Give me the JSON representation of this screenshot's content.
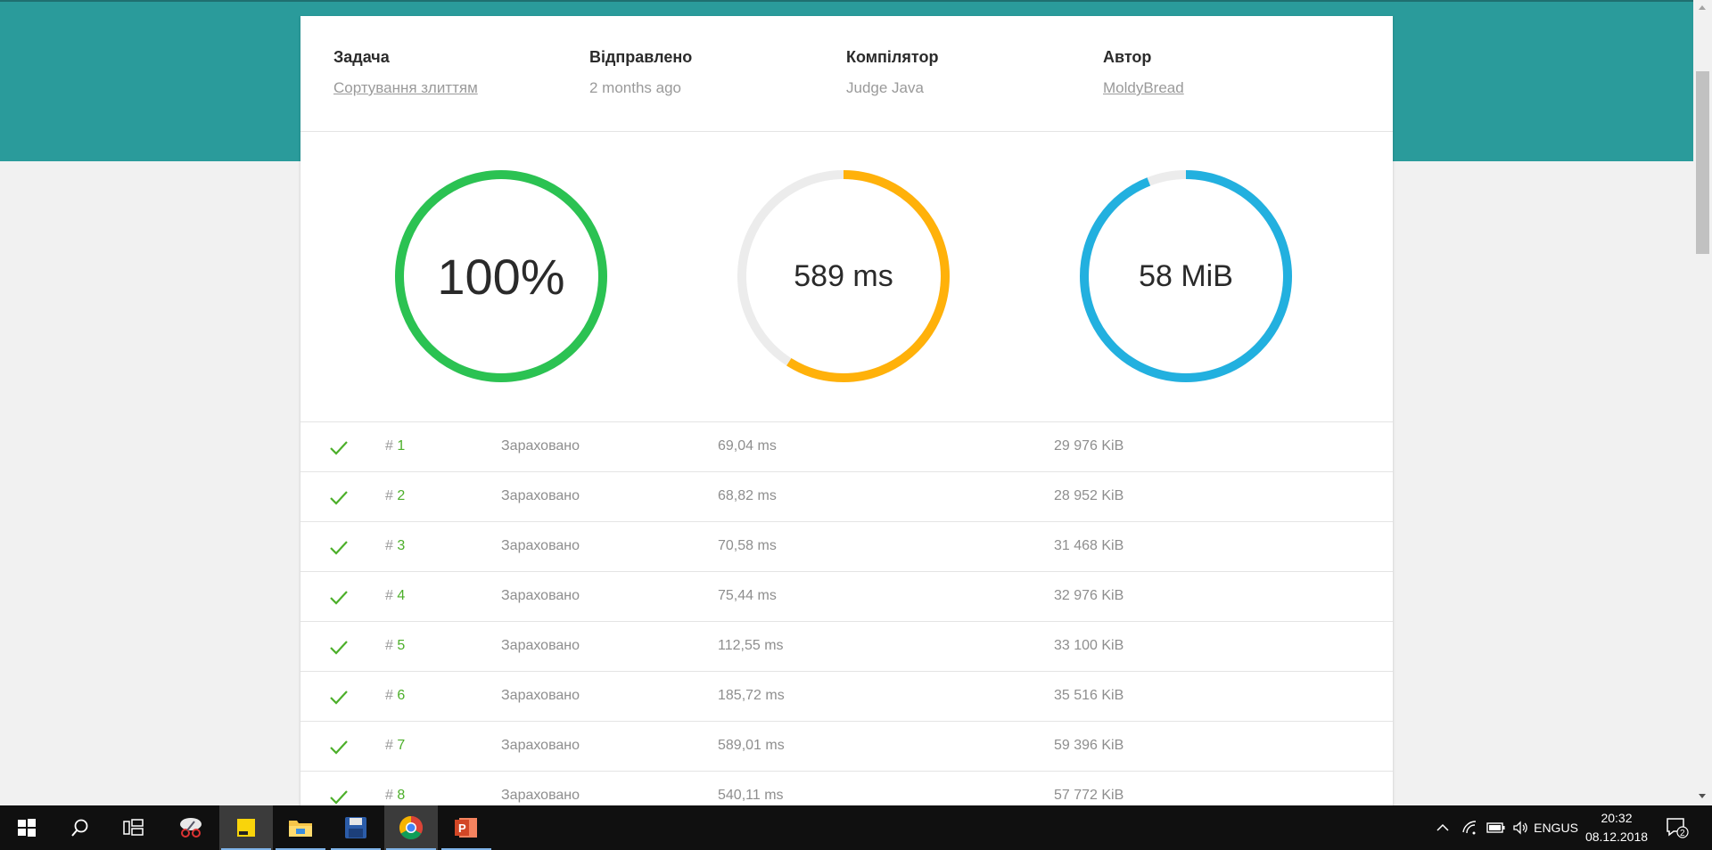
{
  "info": {
    "task": {
      "label": "Задача",
      "value": "Сортування злиттям"
    },
    "sent": {
      "label": "Відправлено",
      "value": "2 months ago"
    },
    "compiler": {
      "label": "Компілятор",
      "value": "Judge Java"
    },
    "author": {
      "label": "Автор",
      "value": "MoldyBread"
    }
  },
  "gauges": {
    "score": {
      "text": "100%",
      "fraction": 1.0,
      "color": "#2bc252"
    },
    "time": {
      "text": "589 ms",
      "fraction": 0.59,
      "color": "#ffb10a"
    },
    "memory": {
      "text": "58 MiB",
      "fraction": 0.94,
      "color": "#22b0df"
    },
    "track_color": "#ececec"
  },
  "tests": [
    {
      "hash": "#",
      "number": "1",
      "status": "Зараховано",
      "time": "69,04 ms",
      "memory": "29 976 KiB"
    },
    {
      "hash": "#",
      "number": "2",
      "status": "Зараховано",
      "time": "68,82 ms",
      "memory": "28 952 KiB"
    },
    {
      "hash": "#",
      "number": "3",
      "status": "Зараховано",
      "time": "70,58 ms",
      "memory": "31 468 KiB"
    },
    {
      "hash": "#",
      "number": "4",
      "status": "Зараховано",
      "time": "75,44 ms",
      "memory": "32 976 KiB"
    },
    {
      "hash": "#",
      "number": "5",
      "status": "Зараховано",
      "time": "112,55 ms",
      "memory": "33 100 KiB"
    },
    {
      "hash": "#",
      "number": "6",
      "status": "Зараховано",
      "time": "185,72 ms",
      "memory": "35 516 KiB"
    },
    {
      "hash": "#",
      "number": "7",
      "status": "Зараховано",
      "time": "589,01 ms",
      "memory": "59 396 KiB"
    },
    {
      "hash": "#",
      "number": "8",
      "status": "Зараховано",
      "time": "540,11 ms",
      "memory": "57 772 KiB"
    }
  ],
  "colors": {
    "teal": "#2a9b9b",
    "check": "#4caf2a"
  },
  "taskbar": {
    "apps": [
      "windows-start-icon",
      "search-icon",
      "task-view-icon",
      "snipping-tool-icon",
      "sticky-notes-icon",
      "file-explorer-icon",
      "save-disk-icon",
      "chrome-icon",
      "powerpoint-icon"
    ],
    "language": {
      "line1": "ENG",
      "line2": "US"
    },
    "clock": {
      "time": "20:32",
      "date": "08.12.2018"
    },
    "notifications_count": "2"
  }
}
